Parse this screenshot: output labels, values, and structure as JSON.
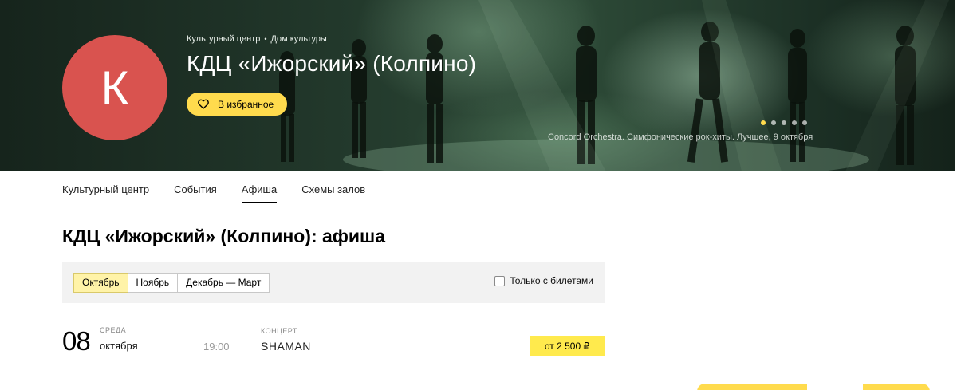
{
  "hero": {
    "avatar_letter": "К",
    "breadcrumb": [
      "Культурный центр",
      "Дом культуры"
    ],
    "breadcrumb_separator": "•",
    "title": "КДЦ «Ижорский» (Колпино)",
    "favorite_label": "В избранное",
    "caption": "Concord Orchestra. Симфонические рок-хиты. Лучшее, 9 октября",
    "carousel": {
      "slides": 5,
      "active_index": 0
    }
  },
  "tabs": [
    {
      "label": "Культурный центр",
      "active": false
    },
    {
      "label": "События",
      "active": false
    },
    {
      "label": "Афиша",
      "active": true
    },
    {
      "label": "Схемы залов",
      "active": false
    }
  ],
  "page_title": "КДЦ «Ижорский» (Колпино): афиша",
  "filters": {
    "months": [
      {
        "label": "Октябрь",
        "selected": true
      },
      {
        "label": "Ноябрь",
        "selected": false
      },
      {
        "label": "Декабрь — Март",
        "selected": false
      }
    ],
    "only_tickets_label": "Только с билетами",
    "only_tickets_checked": false
  },
  "events": [
    {
      "day": "08",
      "weekday": "среда",
      "month": "октября",
      "time": "19:00",
      "category": "концерт",
      "name": "SHAMAN",
      "price": "от 2 500 ₽"
    }
  ],
  "colors": {
    "accent_yellow": "#ffdb4d",
    "avatar_red": "#d9534f",
    "selected_segment": "#fff3a8"
  },
  "icons": {
    "favorite": "heart-outline-icon",
    "checkbox": "checkbox-empty-icon"
  }
}
